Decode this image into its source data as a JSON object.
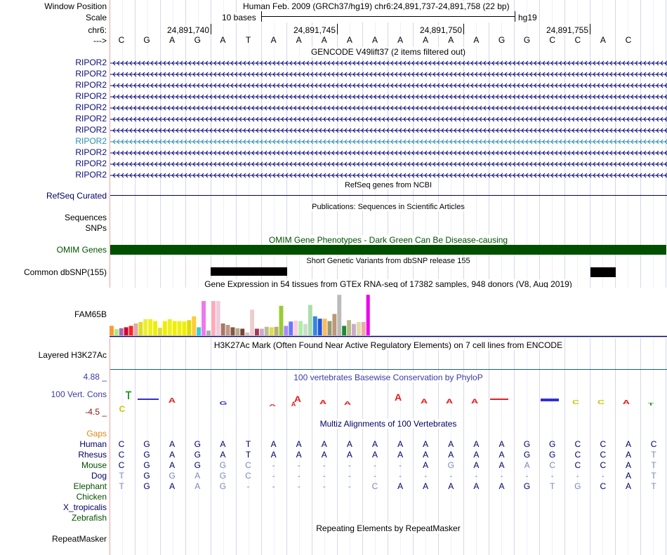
{
  "header": {
    "window_position_label": "Window Position",
    "window_position_value": "Human Feb. 2009 (GRCh37/hg19)   chr6:24,891,737-24,891,758 (22 bp)",
    "scale_label": "Scale",
    "scale_value": "10 bases",
    "scale_assembly": "hg19",
    "chrom_label": "chr6:",
    "strand_label": "--->",
    "positions": [
      "24,891,740",
      "24,891,745",
      "24,891,750",
      "24,891,755"
    ]
  },
  "bases": [
    "C",
    "G",
    "A",
    "G",
    "A",
    "T",
    "A",
    "A",
    "A",
    "A",
    "A",
    "A",
    "A",
    "A",
    "A",
    "G",
    "G",
    "C",
    "C",
    "A",
    "C"
  ],
  "gencode": {
    "title": "GENCODE V49lift37 (2 items filtered out)",
    "rows": [
      "RIPOR2",
      "RIPOR2",
      "RIPOR2",
      "RIPOR2",
      "RIPOR2",
      "RIPOR2",
      "RIPOR2",
      "RIPOR2",
      "RIPOR2",
      "RIPOR2",
      "RIPOR2"
    ],
    "highlight_index": 7,
    "colors": {
      "normal": "#0c0c78",
      "highlight": "#2a8fb0"
    }
  },
  "refseq": {
    "title": "RefSeq genes from NCBI",
    "label": "RefSeq Curated"
  },
  "publications": {
    "title": "Publications: Sequences in Scientific Articles",
    "label1": "Sequences",
    "label2": "SNPs"
  },
  "omim": {
    "title": "OMIM Gene Phenotypes - Dark Green Can Be Disease-causing",
    "label": "OMIM Genes",
    "color": "#005000"
  },
  "dbsnp": {
    "title": "Short Genetic Variants from dbSNP release 155",
    "label": "Common dbSNP(155)"
  },
  "gtex": {
    "title": "Gene Expression in 54 tissues from GTEx RNA-seq of 17382 samples, 948 donors (V8, Aug 2019)",
    "label": "FAM65B",
    "bar_levels": [
      0.2,
      0.13,
      0.15,
      0.17,
      0.2,
      0.25,
      0.28,
      0.34,
      0.34,
      0.3,
      0.16,
      0.3,
      0.34,
      0.3,
      0.3,
      0.29,
      0.32,
      0.4,
      0.17,
      0.72,
      0.1,
      0.72,
      0.72,
      0.25,
      0.22,
      0.17,
      0.15,
      0.14,
      0.06,
      0.54,
      0.14,
      0.14,
      0.18,
      0.17,
      0.18,
      0.62,
      0.2,
      0.29,
      0.31,
      0.3,
      0.24,
      0.64,
      0.4,
      0.35,
      0.35,
      0.3,
      0.45,
      0.85,
      0.2,
      0.32,
      0.24,
      0.28,
      0.28,
      0.85
    ],
    "bar_colors": [
      "#ff9933",
      "#aaee77",
      "#aa66aa",
      "#cc0033",
      "#ff2222",
      "#ddaaaa",
      "#dddd22",
      "#eeee33",
      "#eeee22",
      "#eeee00",
      "#dddd33",
      "#eeee00",
      "#eeee22",
      "#eeee00",
      "#eeee11",
      "#eeee00",
      "#dddd00",
      "#ffcc33",
      "#33ccdd",
      "#ee77ee",
      "#aaaaaa",
      "#ffaabb",
      "#eeccdd",
      "#aa7766",
      "#bb9988",
      "#885544",
      "#bbaa88",
      "#774433",
      "#ddbbbb",
      "#eecccc",
      "#aa3355",
      "#ccaacc",
      "#bbbb99",
      "#dddd44",
      "#bbaa77",
      "#99cc33",
      "#aa88ff",
      "#6677ff",
      "#ffccdd",
      "#aaeeaa",
      "#ccddcc",
      "#aaddaa",
      "#3388dd",
      "#2255dd",
      "#ffbb55",
      "#999977",
      "#bb9977",
      "#bbbbbb",
      "#228833",
      "#bbbb88",
      "#ccaacc",
      "#ddddaa",
      "#eeaaaa",
      "#ee00ee"
    ]
  },
  "h3k27ac": {
    "title": "H3K27Ac Mark (Often Found Near Active Regulatory Elements) on 7 cell lines from ENCODE",
    "label": "Layered H3K27Ac"
  },
  "phylop": {
    "title": "100 vertebrates Basewise Conservation by PhyloP",
    "label": "100 Vert. Cons",
    "max": "4.88 _",
    "min": "-4.5 _"
  },
  "multiz": {
    "title": "Multiz Alignments of 100 Vertebrates",
    "gaps_label": "Gaps",
    "species": [
      {
        "name": "Human",
        "color": "#000066",
        "bases": [
          "C",
          "G",
          "A",
          "G",
          "A",
          "T",
          "A",
          "A",
          "A",
          "A",
          "A",
          "A",
          "A",
          "A",
          "A",
          "A",
          "G",
          "G",
          "C",
          "C",
          "A",
          "C"
        ]
      },
      {
        "name": "Rhesus",
        "color": "#000066",
        "bases": [
          "C",
          "G",
          "A",
          "G",
          "A",
          "T",
          "A",
          "A",
          "A",
          "A",
          "A",
          "A",
          "A",
          "A",
          "A",
          "A",
          "G",
          "G",
          "C",
          "C",
          "A",
          "T"
        ]
      },
      {
        "name": "Mouse",
        "color": "#005000",
        "bases": [
          "C",
          "G",
          "A",
          "G",
          "G",
          "C",
          "-",
          "-",
          "-",
          "-",
          "-",
          "-",
          "A",
          "G",
          "A",
          "A",
          "A",
          "C",
          "C",
          "C",
          "A",
          "T"
        ]
      },
      {
        "name": "Dog",
        "color": "#000066",
        "bases": [
          "T",
          "G",
          "G",
          "A",
          "G",
          "C",
          "-",
          "-",
          "-",
          "-",
          "-",
          "-",
          "-",
          "-",
          "-",
          "-",
          "-",
          "-",
          "-",
          "-",
          "A",
          "T"
        ]
      },
      {
        "name": "Elephant",
        "color": "#005000",
        "bases": [
          "T",
          "G",
          "A",
          "A",
          "G",
          "-",
          "-",
          "-",
          "-",
          "-",
          "C",
          "A",
          "A",
          "A",
          "A",
          "A",
          "G",
          "T",
          "G",
          "C",
          "A",
          "T"
        ]
      },
      {
        "name": "Chicken",
        "color": "#005000",
        "bases": []
      },
      {
        "name": "X_tropicalis",
        "color": "#000066",
        "bases": []
      },
      {
        "name": "Zebrafish",
        "color": "#005000",
        "bases": []
      }
    ]
  },
  "repeatmasker": {
    "title": "Repeating Elements by RepeatMasker",
    "label": "RepeatMasker"
  }
}
